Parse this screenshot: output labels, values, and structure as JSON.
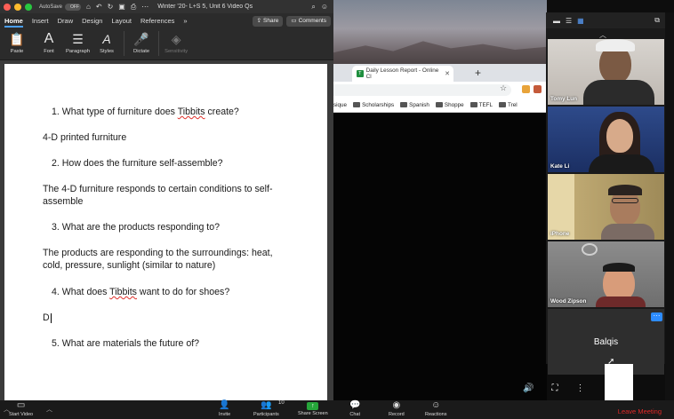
{
  "word": {
    "autosave_label": "AutoSave",
    "autosave_state": "OFF",
    "doc_title": "Winter '20- L+S 5, Unit 6 Video Qs",
    "tabs": [
      {
        "label": "Home",
        "active": true
      },
      {
        "label": "Insert",
        "active": false
      },
      {
        "label": "Draw",
        "active": false
      },
      {
        "label": "Design",
        "active": false
      },
      {
        "label": "Layout",
        "active": false
      },
      {
        "label": "References",
        "active": false
      },
      {
        "label": "»",
        "active": false
      }
    ],
    "share_label": "Share",
    "comments_label": "Comments",
    "ribbon": {
      "paste": "Paste",
      "font": "Font",
      "paragraph": "Paragraph",
      "styles": "Styles",
      "dictate": "Dictate",
      "sensitivity": "Sensitivity"
    },
    "document": {
      "q1_pre": "1. What type of furniture does ",
      "q1_spell": "Tibbits",
      "q1_post": " create?",
      "a1": "4-D printed furniture",
      "q2": "2. How does the furniture self-assemble?",
      "a2": "The 4-D furniture responds to certain conditions to self-assemble",
      "q3": "3. What are the products responding to?",
      "a3": "The products are responding to the surroundings: heat, cold, pressure, sunlight (similar to nature)",
      "q4_pre": "4. What does ",
      "q4_spell": "Tibbits",
      "q4_post": " want to do for shoes?",
      "a4": "D",
      "q5": "5. What are materials the future of?"
    }
  },
  "chrome": {
    "tab_title": "Daily Lesson Report - Online Cl",
    "tab_favicon": "T",
    "new_tab": "+",
    "bookmarks": [
      "sique",
      "Scholarships",
      "Spanish",
      "Shoppe",
      "TEFL",
      "Trel"
    ]
  },
  "zoom": {
    "participants": [
      {
        "name": "Tomy Lun"
      },
      {
        "name": "Kate Li"
      },
      {
        "name": "iPhone"
      },
      {
        "name": "Wood Zipson"
      },
      {
        "name": "Balqis"
      }
    ],
    "more_label": "···",
    "toolbar": {
      "start_video": "Start Video",
      "invite": "Invite",
      "participants": "Participants",
      "participants_count": "10",
      "share_screen": "Share Screen",
      "chat": "Chat",
      "record": "Record",
      "reactions": "Reactions",
      "leave": "Leave Meeting"
    },
    "colors": {
      "accent": "#2d8cff",
      "share_green": "#26a53a",
      "leave_red": "#e02828"
    }
  }
}
